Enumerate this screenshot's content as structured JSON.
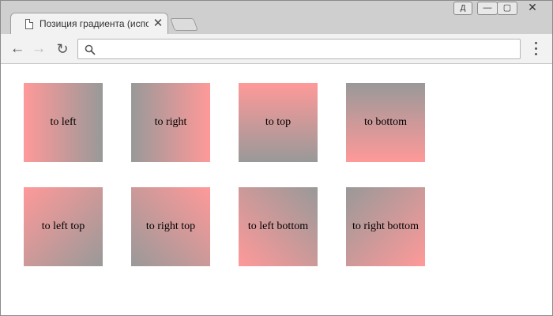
{
  "browser": {
    "tab_title": "Позиция градиента (использование",
    "tab_close": "✕",
    "user_label": "Д",
    "minimize": "—",
    "maximize": "▢",
    "close": "✕",
    "back": "←",
    "forward": "→",
    "reload": "↻",
    "address_value": "",
    "address_placeholder": ""
  },
  "colors": {
    "gray": "#999999",
    "pink": "#ff9999"
  },
  "gradients": [
    {
      "label": "to left",
      "direction": "to left"
    },
    {
      "label": "to right",
      "direction": "to right"
    },
    {
      "label": "to top",
      "direction": "to top"
    },
    {
      "label": "to bottom",
      "direction": "to bottom"
    },
    {
      "label": "to left top",
      "direction": "to left top"
    },
    {
      "label": "to right top",
      "direction": "to right top"
    },
    {
      "label": "to left bottom",
      "direction": "to left bottom"
    },
    {
      "label": "to right bottom",
      "direction": "to right bottom"
    }
  ]
}
